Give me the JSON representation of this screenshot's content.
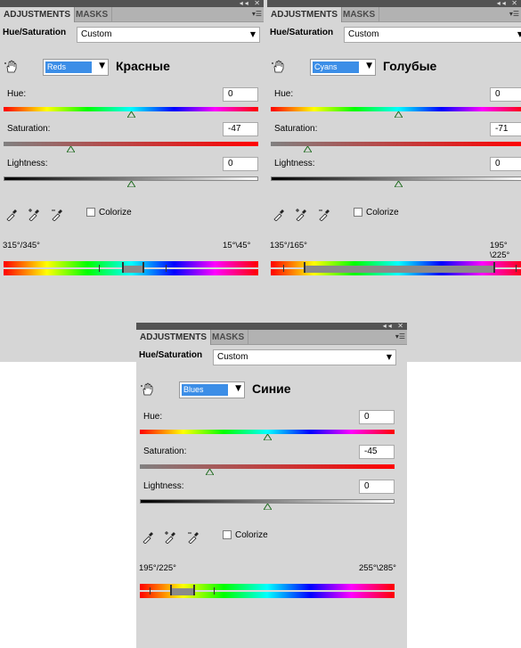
{
  "panels": [
    {
      "tabs": {
        "active": "ADJUSTMENTS",
        "inactive": "MASKS"
      },
      "title": "Hue/Saturation",
      "preset": "Custom",
      "edit_value": "Reds",
      "ru_label": "Красные",
      "hue": {
        "label": "Hue:",
        "value": "0",
        "level": 0.5
      },
      "saturation": {
        "label": "Saturation:",
        "value": "-47",
        "level": 0.265
      },
      "lightness": {
        "label": "Lightness:",
        "value": "0",
        "level": 0.5
      },
      "colorize": "Colorize",
      "range_left": "315°/345°",
      "range_right": "15°\\45°",
      "range_markers": [
        0.375,
        0.465,
        0.545,
        0.635
      ]
    },
    {
      "tabs": {
        "active": "ADJUSTMENTS",
        "inactive": "MASKS"
      },
      "title": "Hue/Saturation",
      "preset": "Custom",
      "edit_value": "Cyans",
      "ru_label": "Голубые",
      "hue": {
        "label": "Hue:",
        "value": "0",
        "level": 0.5
      },
      "saturation": {
        "label": "Saturation:",
        "value": "-71",
        "level": 0.145
      },
      "lightness": {
        "label": "Lightness:",
        "value": "0",
        "level": 0.5
      },
      "colorize": "Colorize",
      "range_left": "135°/165°",
      "range_right": "195°\\225°",
      "range_markers": [
        0.05,
        0.13,
        0.875,
        0.96
      ]
    },
    {
      "tabs": {
        "active": "ADJUSTMENTS",
        "inactive": "MASKS"
      },
      "title": "Hue/Saturation",
      "preset": "Custom",
      "edit_value": "Blues",
      "ru_label": "Синие",
      "hue": {
        "label": "Hue:",
        "value": "0",
        "level": 0.5
      },
      "saturation": {
        "label": "Saturation:",
        "value": "-45",
        "level": 0.275
      },
      "lightness": {
        "label": "Lightness:",
        "value": "0",
        "level": 0.5
      },
      "colorize": "Colorize",
      "range_left": "195°/225°",
      "range_right": "255°\\285°",
      "range_markers": [
        0.04,
        0.12,
        0.21,
        0.29
      ]
    }
  ],
  "icons": {
    "hand": "hand-adjust-icon",
    "eyedropper": "eyedropper-icon",
    "eyedropper_plus": "eyedropper-plus-icon",
    "eyedropper_minus": "eyedropper-minus-icon"
  },
  "colors": {
    "panel_bg": "#d6d6d6",
    "tab_bar": "#b2b2b2",
    "title_bar": "#535353",
    "selection": "#3c8ee7"
  }
}
